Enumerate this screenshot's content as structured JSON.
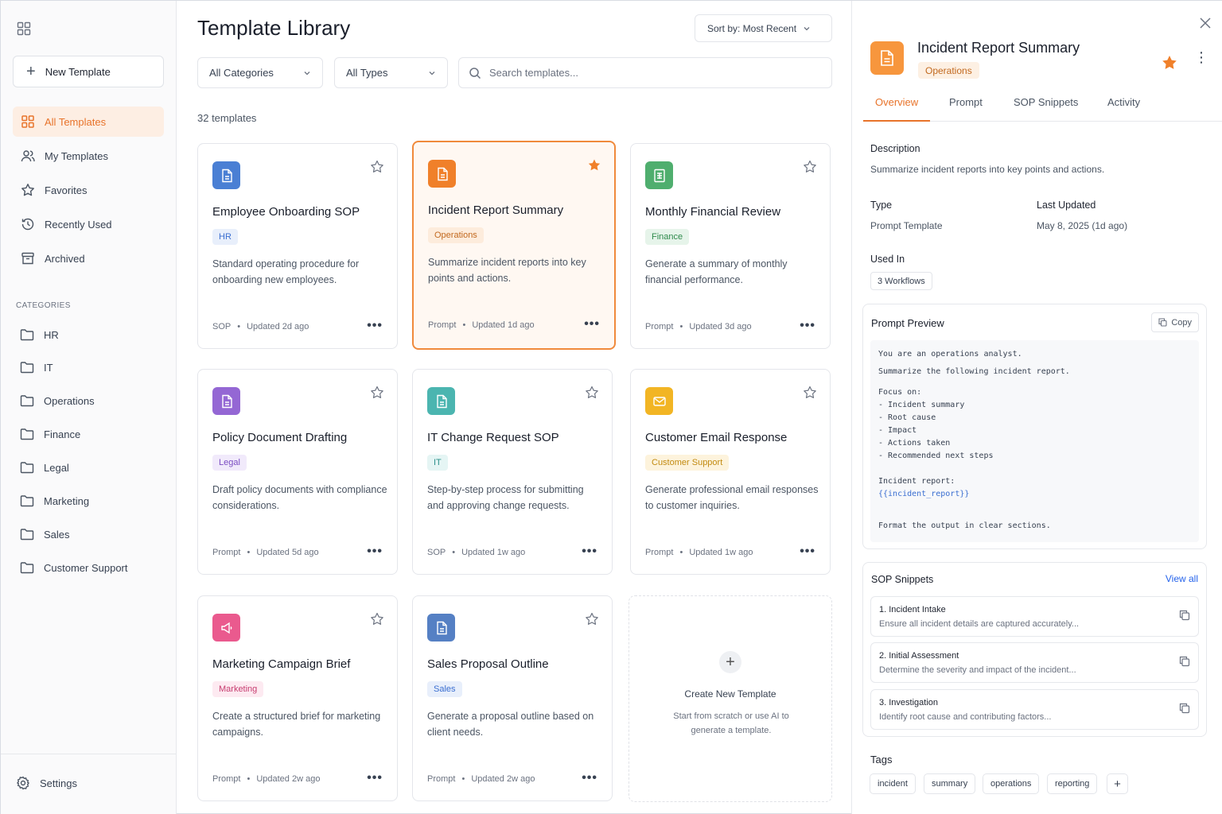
{
  "sidebar": {
    "new_template_label": "New Template",
    "nav": [
      {
        "label": "All Templates",
        "icon": "grid-icon",
        "active": true
      },
      {
        "label": "My Templates",
        "icon": "users-icon"
      },
      {
        "label": "Favorites",
        "icon": "star-icon"
      },
      {
        "label": "Recently Used",
        "icon": "history-icon"
      },
      {
        "label": "Archived",
        "icon": "archive-icon"
      }
    ],
    "categories_label": "CATEGORIES",
    "categories": [
      "HR",
      "IT",
      "Operations",
      "Finance",
      "Legal",
      "Marketing",
      "Sales",
      "Customer Support"
    ],
    "settings_label": "Settings"
  },
  "main": {
    "title": "Template Library",
    "sort_label": "Sort by: Most Recent",
    "filter_category": "All Categories",
    "filter_type": "All Types",
    "search_placeholder": "Search templates...",
    "count_text": "32 templates",
    "cards": [
      {
        "title": "Employee Onboarding SOP",
        "tag": "HR",
        "desc": "Standard operating procedure for onboarding new employees.",
        "type": "SOP",
        "updated": "Updated 2d ago",
        "icon_color": "#4a7fd4",
        "tag_bg": "#e8effb",
        "tag_fg": "#3b6fd1",
        "starred": false,
        "selected": false
      },
      {
        "title": "Incident Report Summary",
        "tag": "Operations",
        "desc": "Summarize incident reports into key points and actions.",
        "type": "Prompt",
        "updated": "Updated 1d ago",
        "icon_color": "#f0802a",
        "tag_bg": "#fdecdc",
        "tag_fg": "#c2691f",
        "starred": true,
        "selected": true
      },
      {
        "title": "Monthly Financial Review",
        "tag": "Finance",
        "desc": "Generate a summary of monthly financial performance.",
        "type": "Prompt",
        "updated": "Updated 3d ago",
        "icon_color": "#4fae6e",
        "tag_bg": "#e6f4ea",
        "tag_fg": "#2f8a4c",
        "starred": false,
        "selected": false
      },
      {
        "title": "Policy Document Drafting",
        "tag": "Legal",
        "desc": "Draft policy documents with compliance considerations.",
        "type": "Prompt",
        "updated": "Updated 5d ago",
        "icon_color": "#9467d4",
        "tag_bg": "#f1eafb",
        "tag_fg": "#7b4cc2",
        "starred": false,
        "selected": false
      },
      {
        "title": "IT Change Request SOP",
        "tag": "IT",
        "desc": "Step-by-step process for submitting and approving change requests.",
        "type": "SOP",
        "updated": "Updated 1w ago",
        "icon_color": "#4bb5b0",
        "tag_bg": "#e5f5f4",
        "tag_fg": "#2e918c",
        "starred": false,
        "selected": false
      },
      {
        "title": "Customer Email Response",
        "tag": "Customer Support",
        "desc": "Generate professional email responses to customer inquiries.",
        "type": "Prompt",
        "updated": "Updated 1w ago",
        "icon_color": "#f2b524",
        "tag_bg": "#fdf3dc",
        "tag_fg": "#c28a10",
        "starred": false,
        "selected": false
      },
      {
        "title": "Marketing Campaign Brief",
        "tag": "Marketing",
        "desc": "Create a structured brief for marketing campaigns.",
        "type": "Prompt",
        "updated": "Updated 2w ago",
        "icon_color": "#ea5a8e",
        "tag_bg": "#fdeaf1",
        "tag_fg": "#c73d70",
        "starred": false,
        "selected": false
      },
      {
        "title": "Sales Proposal Outline",
        "tag": "Sales",
        "desc": "Generate a proposal outline based on client needs.",
        "type": "Prompt",
        "updated": "Updated 2w ago",
        "icon_color": "#5580c4",
        "tag_bg": "#e8effb",
        "tag_fg": "#3b6fd1",
        "starred": false,
        "selected": false
      }
    ],
    "create": {
      "title": "Create New Template",
      "desc": "Start from scratch or use AI to generate a template."
    }
  },
  "panel": {
    "title": "Incident Report Summary",
    "tag": "Operations",
    "tabs": [
      "Overview",
      "Prompt",
      "SOP Snippets",
      "Activity"
    ],
    "description_label": "Description",
    "description": "Summarize incident reports into key points and actions.",
    "type_label": "Type",
    "type": "Prompt Template",
    "updated_label": "Last Updated",
    "updated": "May 8, 2025 (1d ago)",
    "used_in_label": "Used In",
    "used_in": "3 Workflows",
    "preview_label": "Prompt Preview",
    "copy_label": "Copy",
    "prompt_lines": [
      {
        "text": "You are an operations analyst.",
        "gap": 0
      },
      {
        "text": "Summarize the following incident report.",
        "gap": 6
      },
      {
        "text": "Focus on:",
        "gap": 10
      },
      {
        "text": "- Incident summary",
        "gap": 0
      },
      {
        "text": "- Root cause",
        "gap": 0
      },
      {
        "text": "- Impact",
        "gap": 0
      },
      {
        "text": "- Actions taken",
        "gap": 0
      },
      {
        "text": "- Recommended next steps",
        "gap": 0
      },
      {
        "text": "Incident report:",
        "gap": 16
      },
      {
        "text": "{{incident_report}}",
        "gap": 0,
        "var": true
      },
      {
        "text": "Format the output in clear sections.",
        "gap": 24
      }
    ],
    "snippets_label": "SOP Snippets",
    "view_all_label": "View all",
    "snippets": [
      {
        "title": "1.  Incident Intake",
        "desc": "Ensure all incident details are captured accurately..."
      },
      {
        "title": "2.  Initial Assessment",
        "desc": "Determine the severity and impact of the incident..."
      },
      {
        "title": "3.  Investigation",
        "desc": "Identify root cause and contributing factors..."
      }
    ],
    "tags_label": "Tags",
    "tags": [
      "incident",
      "summary",
      "operations",
      "reporting"
    ]
  },
  "colors": {
    "accent": "#e8732a",
    "link": "#2563eb",
    "star_active": "#f0802a"
  }
}
